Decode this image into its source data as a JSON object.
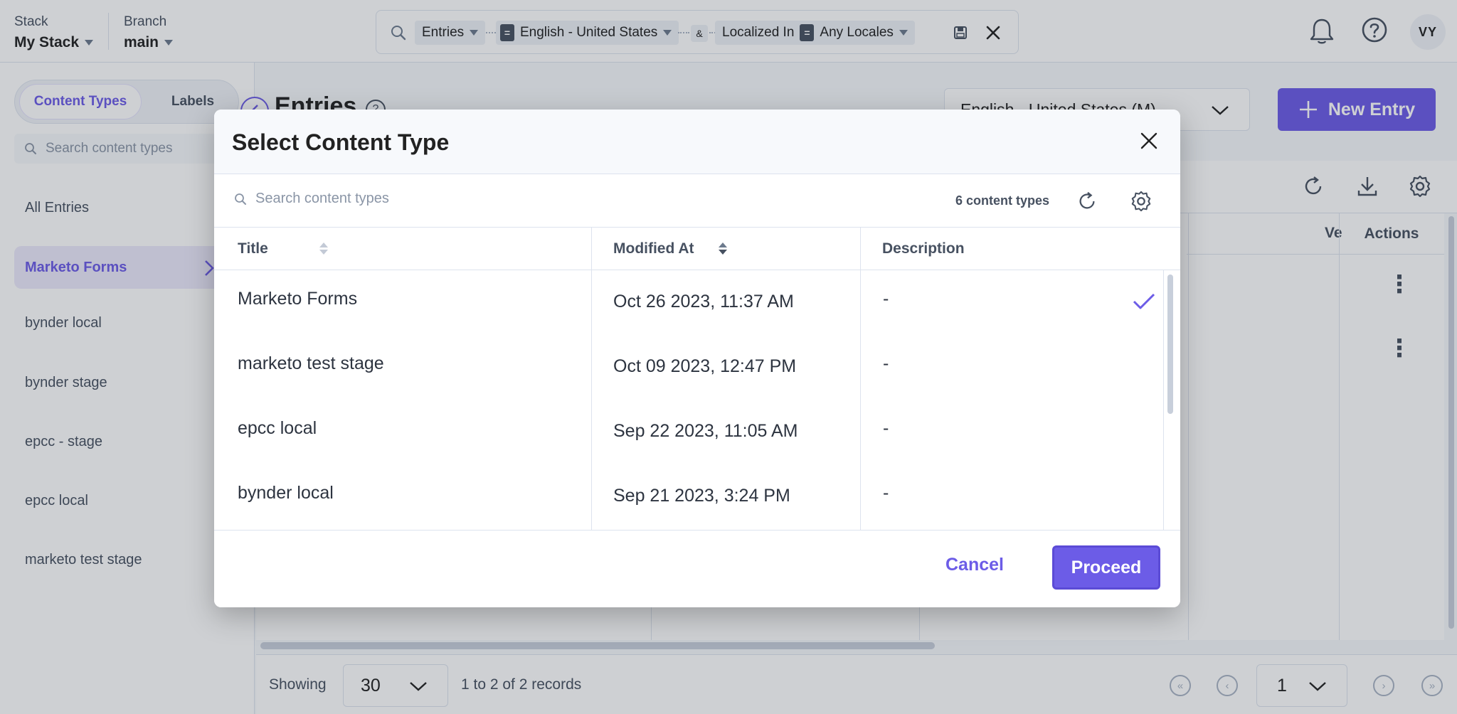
{
  "topbar": {
    "stack_label": "Stack",
    "stack_value": "My Stack",
    "branch_label": "Branch",
    "branch_value": "main",
    "filters": {
      "entries": "Entries",
      "locale": "English - United States",
      "and": "&",
      "localized_in": "Localized In",
      "locales_value": "Any Locales",
      "operator_symbol": "="
    },
    "avatar_initials": "VY"
  },
  "sidebar": {
    "tabs": [
      {
        "label": "Content Types",
        "active": true
      },
      {
        "label": "Labels",
        "active": false
      }
    ],
    "search_placeholder": "Search content types",
    "items": [
      {
        "label": "All Entries",
        "active": false
      },
      {
        "label": "Marketo Forms",
        "active": true
      },
      {
        "label": "bynder local",
        "active": false
      },
      {
        "label": "bynder stage",
        "active": false
      },
      {
        "label": "epcc - stage",
        "active": false
      },
      {
        "label": "epcc local",
        "active": false
      },
      {
        "label": "marketo test stage",
        "active": false
      }
    ]
  },
  "main": {
    "title": "Entries",
    "locale_select": "English - United States (M)",
    "new_entry_label": "New Entry",
    "columns": {
      "version_partial": "Ve",
      "actions": "Actions"
    },
    "footer": {
      "showing_label": "Showing",
      "page_size": "30",
      "records_text": "1 to 2 of 2 records",
      "current_page": "1"
    }
  },
  "modal": {
    "title": "Select Content Type",
    "search_placeholder": "Search content types",
    "count_text": "6 content types",
    "headers": {
      "title": "Title",
      "modified_at": "Modified At",
      "description": "Description"
    },
    "rows": [
      {
        "title": "Marketo Forms",
        "modified_at": "Oct 26 2023, 11:37 AM",
        "description": "-",
        "selected": true
      },
      {
        "title": "marketo test stage",
        "modified_at": "Oct 09 2023, 12:47 PM",
        "description": "-",
        "selected": false
      },
      {
        "title": "epcc local",
        "modified_at": "Sep 22 2023, 11:05 AM",
        "description": "-",
        "selected": false
      },
      {
        "title": "bynder local",
        "modified_at": "Sep 21 2023, 3:24 PM",
        "description": "-",
        "selected": false
      }
    ],
    "cancel_label": "Cancel",
    "proceed_label": "Proceed"
  },
  "colors": {
    "accent": "#6c5ce7",
    "text_primary": "#222222",
    "text_secondary": "#475161",
    "border": "#dde3ee"
  },
  "icons": [
    "search-icon",
    "chevron-down-icon",
    "save-filter-icon",
    "close-icon",
    "bell-icon",
    "help-icon",
    "refresh-icon",
    "settings-icon",
    "download-icon",
    "checkmark-icon",
    "plus-icon",
    "kebab-icon",
    "pagination-first-icon",
    "pagination-prev-icon",
    "pagination-next-icon",
    "pagination-last-icon"
  ]
}
